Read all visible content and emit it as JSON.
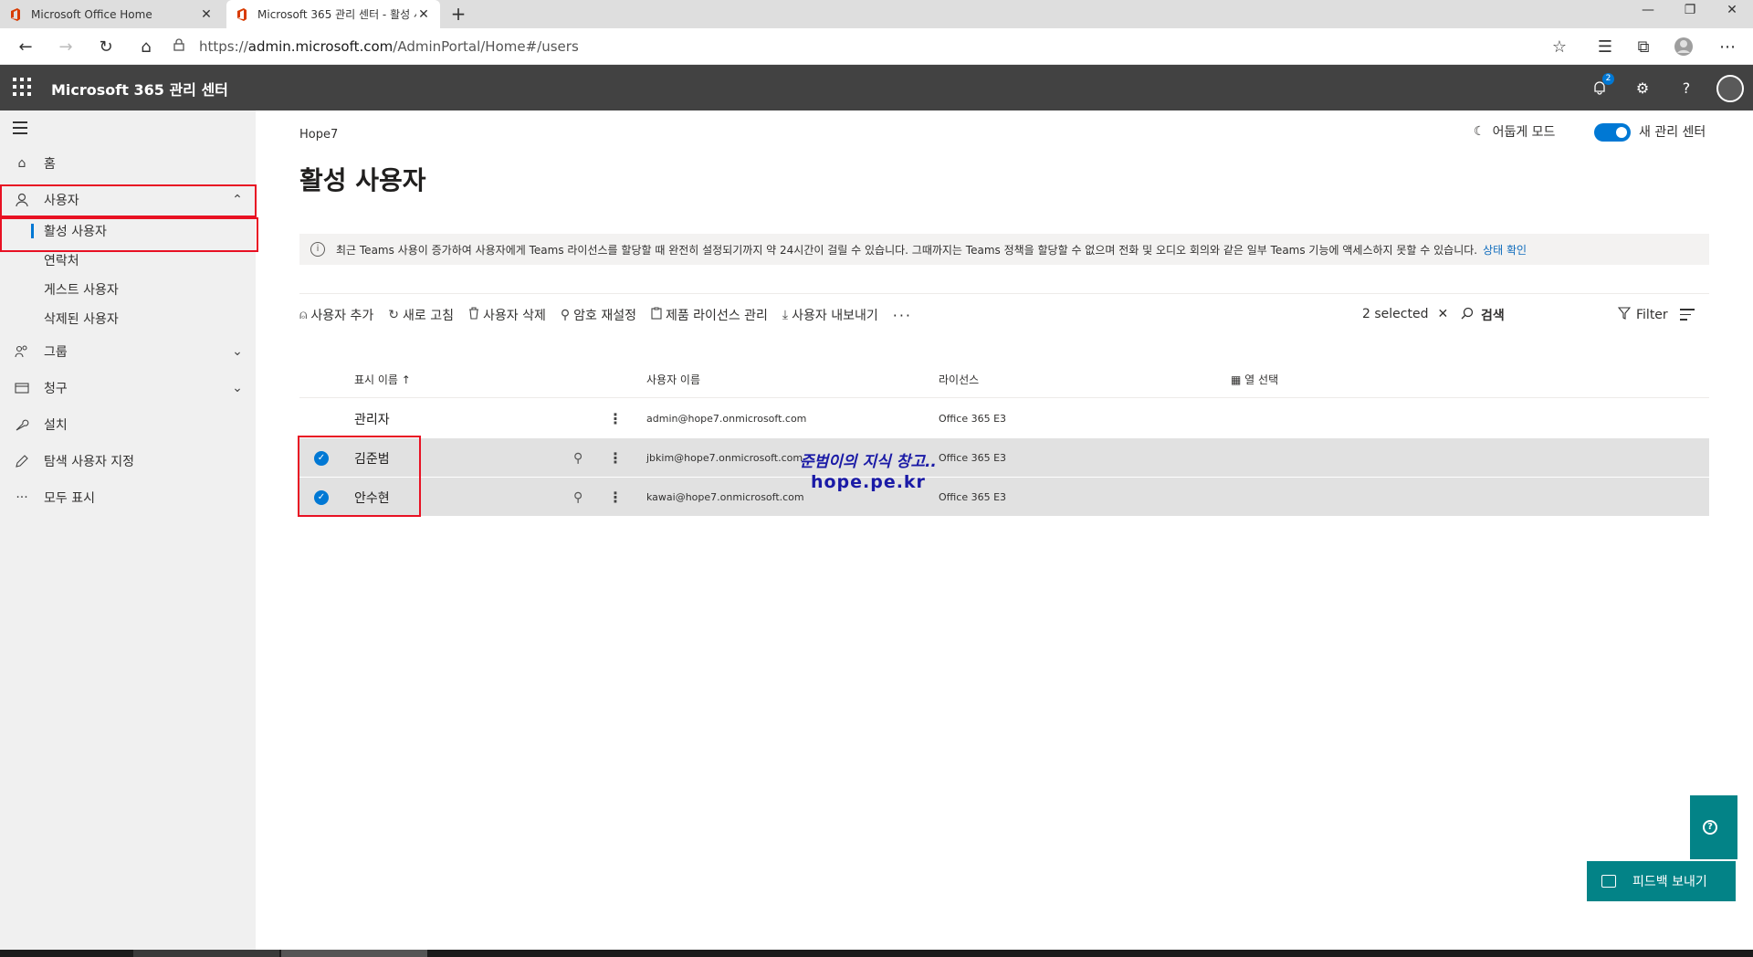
{
  "browser": {
    "tabs": [
      {
        "title": "Microsoft Office Home",
        "active": false
      },
      {
        "title": "Microsoft 365 관리 센터 - 활성 사",
        "active": true
      }
    ],
    "url": {
      "prefix": "https://",
      "host": "admin.microsoft.com",
      "path": "/AdminPortal/Home#/users"
    }
  },
  "header": {
    "app_title": "Microsoft 365 관리 센터",
    "notification_count": "2",
    "help_glyph": "?"
  },
  "sidebar": {
    "items": [
      {
        "label": "홈",
        "icon": "home-icon"
      },
      {
        "label": "사용자",
        "icon": "user-icon"
      },
      {
        "label": "그룹",
        "icon": "group-icon"
      },
      {
        "label": "청구",
        "icon": "billing-icon"
      },
      {
        "label": "설치",
        "icon": "wrench-icon"
      },
      {
        "label": "탐색 사용자 지정",
        "icon": "pencil-icon"
      },
      {
        "label": "모두 표시",
        "icon": "more-icon"
      }
    ],
    "subitems": [
      "활성 사용자",
      "연락처",
      "게스트 사용자",
      "삭제된 사용자"
    ]
  },
  "main": {
    "breadcrumb": "Hope7",
    "dark_mode_label": "어둡게 모드",
    "new_admin_label": "새 관리 센터",
    "title": "활성 사용자",
    "info": {
      "text": "최근 Teams 사용이 증가하여 사용자에게 Teams 라이선스를 할당할 때 완전히 설정되기까지 약 24시간이 걸릴 수 있습니다. 그때까지는 Teams 정책을 할당할 수 없으며 전화 및 오디오 회의와 같은 일부 Teams 기능에 액세스하지 못할 수 있습니다.",
      "link": "상태 확인"
    },
    "commands": [
      "사용자 추가",
      "새로 고침",
      "사용자 삭제",
      "암호 재설정",
      "제품 라이선스 관리",
      "사용자 내보내기"
    ],
    "selected_text": "2 selected",
    "search_label": "검색",
    "filter_label": "Filter",
    "table": {
      "headers": {
        "display_name": "표시 이름 ↑",
        "username": "사용자 이름",
        "license": "라이선스",
        "choose_columns": "열 선택"
      },
      "rows": [
        {
          "name": "관리자",
          "email": "admin@hope7.onmicrosoft.com",
          "license": "Office 365 E3",
          "selected": false
        },
        {
          "name": "김준범",
          "email": "jbkim@hope7.onmicrosoft.com",
          "license": "Office 365 E3",
          "selected": true
        },
        {
          "name": "안수현",
          "email": "kawai@hope7.onmicrosoft.com",
          "license": "Office 365 E3",
          "selected": true
        }
      ]
    },
    "watermark": {
      "line1": "준범이의 지식 창고..",
      "line2": "hope.pe.kr"
    }
  },
  "feedback_label": "피드백 보내기",
  "colors": {
    "accent": "#0078d4",
    "header_bg": "#424242",
    "teal": "#038387",
    "highlight": "#e81123"
  }
}
